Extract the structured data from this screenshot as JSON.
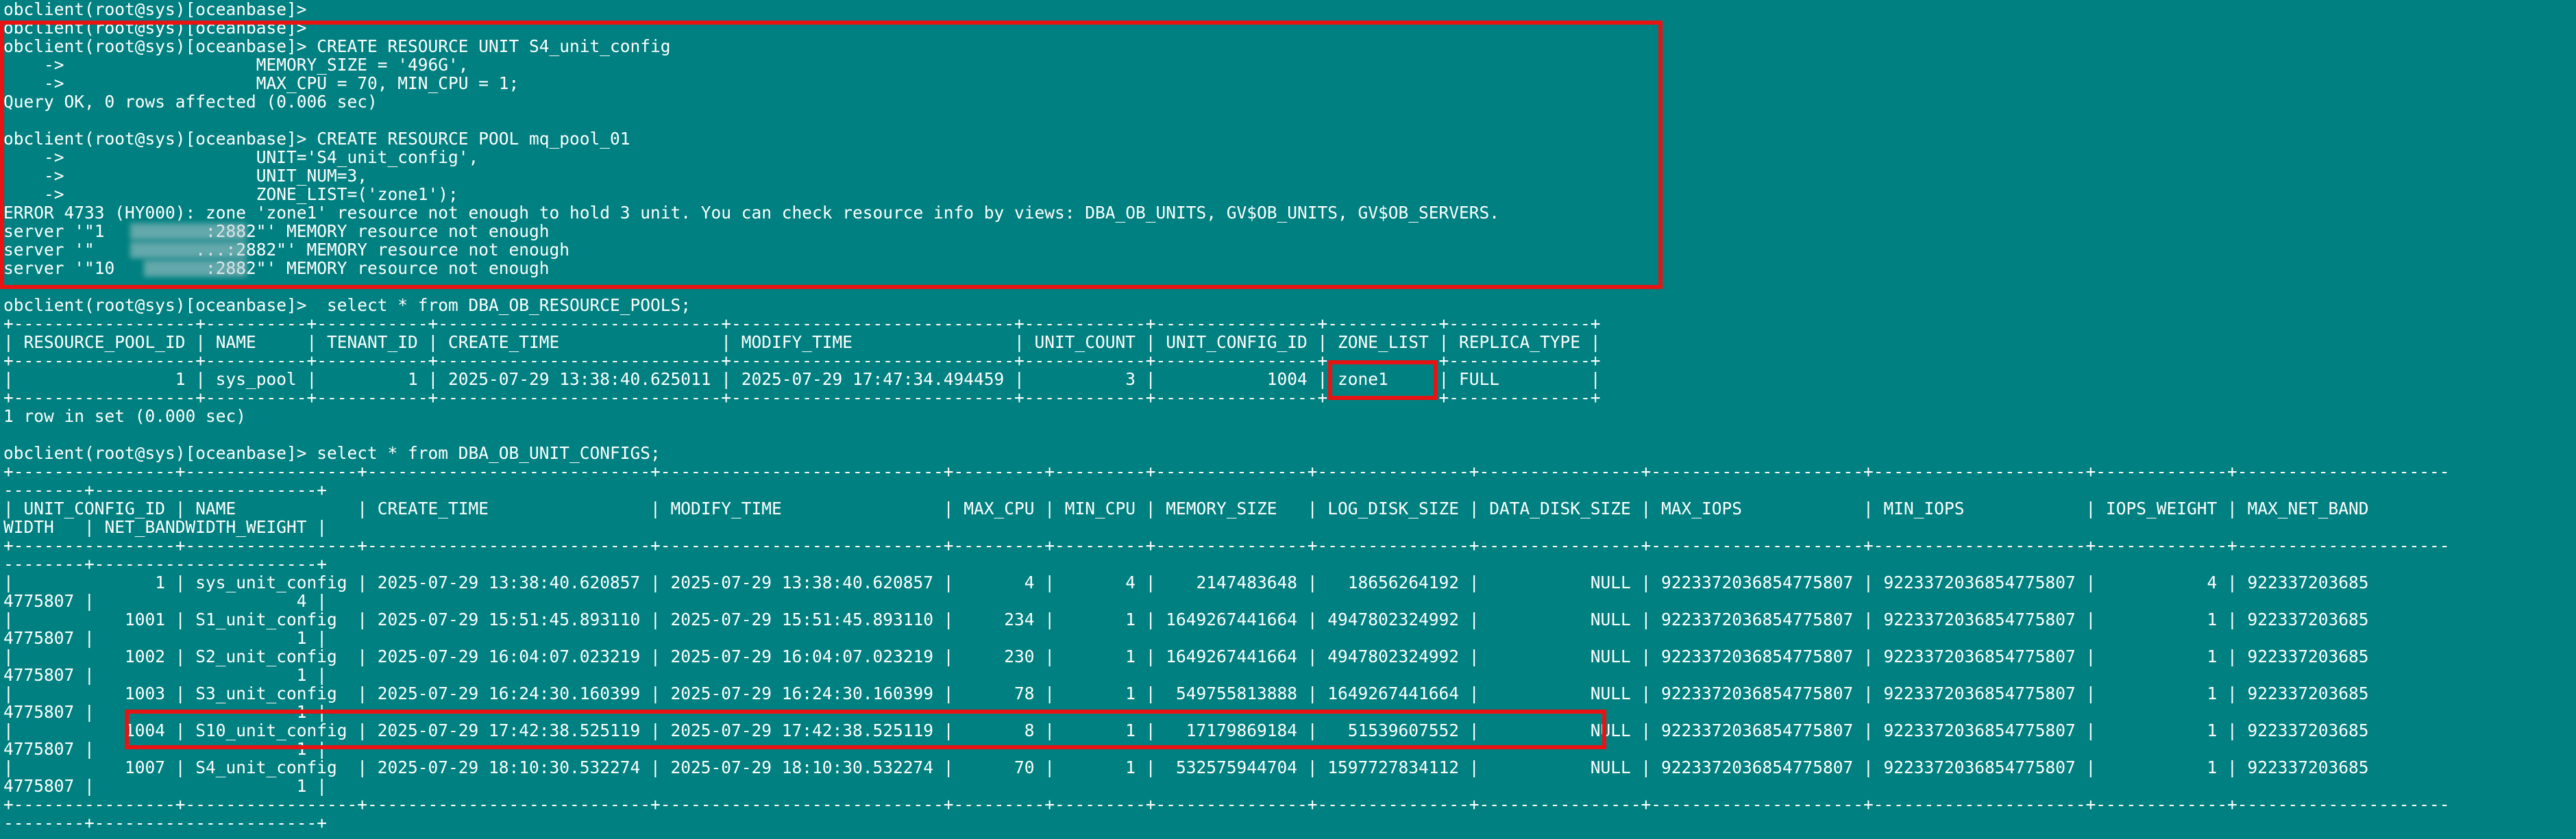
{
  "terminal": {
    "background": "#008080",
    "text_color": "#ffffff",
    "highlight_color": "#e81313",
    "lines": [
      "obclient(root@sys)[oceanbase]>",
      "obclient(root@sys)[oceanbase]>",
      "obclient(root@sys)[oceanbase]> CREATE RESOURCE UNIT S4_unit_config",
      "    ->                   MEMORY_SIZE = '496G',",
      "    ->                   MAX_CPU = 70, MIN_CPU = 1;",
      "Query OK, 0 rows affected (0.006 sec)",
      "",
      "obclient(root@sys)[oceanbase]> CREATE RESOURCE POOL mq_pool_01",
      "    ->                   UNIT='S4_unit_config',",
      "    ->                   UNIT_NUM=3,",
      "    ->                   ZONE_LIST=('zone1');",
      "ERROR 4733 (HY000): zone 'zone1' resource not enough to hold 3 unit. You can check resource info by views: DBA_OB_UNITS, GV$OB_UNITS, GV$OB_SERVERS.",
      "server '\"1          :2882\"' MEMORY resource not enough",
      "server '\"          ...:2882\"' MEMORY resource not enough",
      "server '\"10         :2882\"' MEMORY resource not enough",
      "obclient(root@sys)[oceanbase]>  select * from DBA_OB_RESOURCE_POOLS;",
      "+------------------+----------+-----------+----------------------------+----------------------------+------------+----------------+-----------+--------------+",
      "| RESOURCE_POOL_ID | NAME     | TENANT_ID | CREATE_TIME                | MODIFY_TIME                | UNIT_COUNT | UNIT_CONFIG_ID | ZONE_LIST | REPLICA_TYPE |",
      "+------------------+----------+-----------+----------------------------+----------------------------+------------+----------------+-----------+--------------+",
      "|                1 | sys_pool |         1 | 2025-07-29 13:38:40.625011 | 2025-07-29 17:47:34.494459 |          3 |           1004 | zone1     | FULL         |",
      "+------------------+----------+-----------+----------------------------+----------------------------+------------+----------------+-----------+--------------+",
      "1 row in set (0.000 sec)",
      "",
      "obclient(root@sys)[oceanbase]> select * from DBA_OB_UNIT_CONFIGS;",
      "+----------------+-----------------+----------------------------+----------------------------+---------+---------+---------------+---------------+----------------+---------------------+---------------------+-------------+---------------------",
      "--------+----------------------+",
      "| UNIT_CONFIG_ID | NAME            | CREATE_TIME                | MODIFY_TIME                | MAX_CPU | MIN_CPU | MEMORY_SIZE   | LOG_DISK_SIZE | DATA_DISK_SIZE | MAX_IOPS            | MIN_IOPS            | IOPS_WEIGHT | MAX_NET_BAND",
      "WIDTH   | NET_BANDWIDTH_WEIGHT |",
      "+----------------+-----------------+----------------------------+----------------------------+---------+---------+---------------+---------------+----------------+---------------------+---------------------+-------------+---------------------",
      "--------+----------------------+",
      "|              1 | sys_unit_config | 2025-07-29 13:38:40.620857 | 2025-07-29 13:38:40.620857 |       4 |       4 |    2147483648 |   18656264192 |           NULL | 9223372036854775807 | 9223372036854775807 |           4 | 922337203685",
      "4775807 |                    4 |",
      "|           1001 | S1_unit_config  | 2025-07-29 15:51:45.893110 | 2025-07-29 15:51:45.893110 |     234 |       1 | 1649267441664 | 4947802324992 |           NULL | 9223372036854775807 | 9223372036854775807 |           1 | 922337203685",
      "4775807 |                    1 |",
      "|           1002 | S2_unit_config  | 2025-07-29 16:04:07.023219 | 2025-07-29 16:04:07.023219 |     230 |       1 | 1649267441664 | 4947802324992 |           NULL | 9223372036854775807 | 9223372036854775807 |           1 | 922337203685",
      "4775807 |                    1 |",
      "|           1003 | S3_unit_config  | 2025-07-29 16:24:30.160399 | 2025-07-29 16:24:30.160399 |      78 |       1 |  549755813888 | 1649267441664 |           NULL | 9223372036854775807 | 9223372036854775807 |           1 | 922337203685",
      "4775807 |                    1 |",
      "|           1004 | S10_unit_config | 2025-07-29 17:42:38.525119 | 2025-07-29 17:42:38.525119 |       8 |       1 |   17179869184 |   51539607552 |           NULL | 9223372036854775807 | 9223372036854775807 |           1 | 922337203685",
      "4775807 |                    1 |",
      "|           1007 | S4_unit_config  | 2025-07-29 18:10:30.532274 | 2025-07-29 18:10:30.532274 |      70 |       1 |  532575944704 | 1597727834112 |           NULL | 9223372036854775807 | 9223372036854775807 |           1 | 922337203685",
      "4775807 |                    1 |",
      "+----------------+-----------------+----------------------------+----------------------------+---------+---------+---------------+---------------+----------------+---------------------+---------------------+-------------+---------------------",
      "--------+----------------------+"
    ]
  }
}
